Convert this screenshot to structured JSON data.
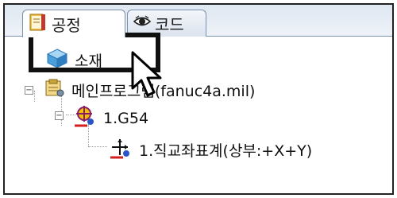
{
  "tabs": [
    {
      "label": "공정",
      "icon": "process-book-icon",
      "active": true
    },
    {
      "label": "코드",
      "icon": "eye-icon",
      "active": false
    }
  ],
  "tree": {
    "material": {
      "label": "소재",
      "icon": "cube-icon"
    },
    "main_program": {
      "label": "메인프로그램(fanuc4a.mil)",
      "icon": "program-icon",
      "expander": "−"
    },
    "work_offset": {
      "label": "1.G54",
      "icon": "work-offset-icon",
      "expander": "−"
    },
    "coordinate": {
      "label": "1.직교좌표계(상부:+X+Y)",
      "icon": "coordinate-axes-icon"
    }
  },
  "colors": {
    "tab_border": "#7a90ae",
    "highlight": "#111111",
    "cube": "#4a9fd8",
    "accent_red": "#d21f1f"
  }
}
